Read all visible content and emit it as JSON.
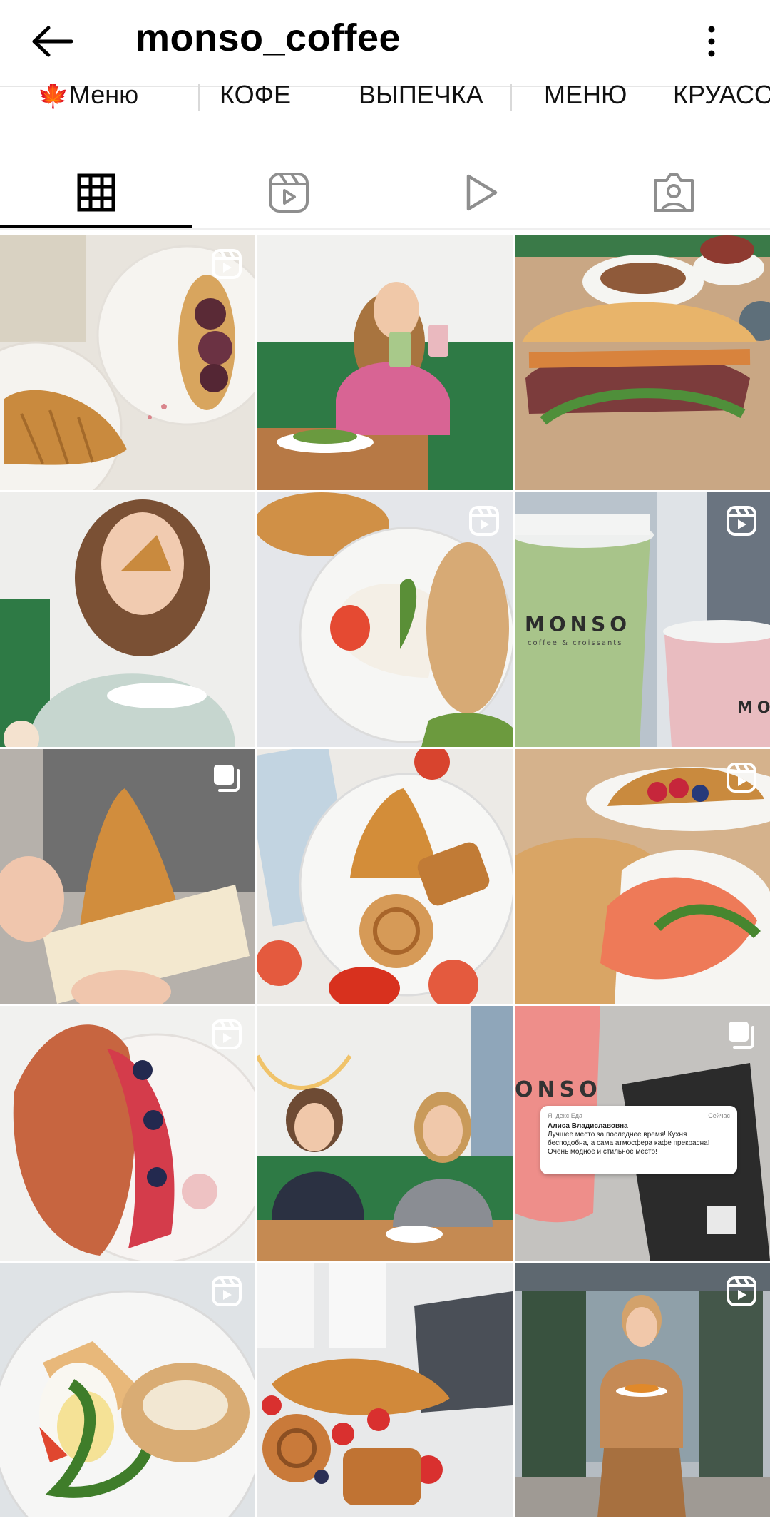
{
  "header": {
    "title": "monso_coffee",
    "back_icon": "arrow-left-icon",
    "more_icon": "more-vertical-icon"
  },
  "highlights": [
    {
      "label": "🍁Меню"
    },
    {
      "label": "КОФЕ"
    },
    {
      "label": "ВЫПЕЧКА"
    },
    {
      "label": "МЕНЮ"
    },
    {
      "label": "КРУАССАНЫ"
    }
  ],
  "tabs": [
    {
      "name": "posts",
      "icon": "grid-icon",
      "active": true
    },
    {
      "name": "reels",
      "icon": "reels-icon",
      "active": false
    },
    {
      "name": "videos",
      "icon": "play-icon",
      "active": false
    },
    {
      "name": "tagged",
      "icon": "tagged-person-icon",
      "active": false
    }
  ],
  "posts": [
    {
      "kind": "reel",
      "subject": "croissant with figs"
    },
    {
      "kind": "photo",
      "subject": "woman with green cup on sofa"
    },
    {
      "kind": "photo",
      "subject": "roast beef croissant sandwich"
    },
    {
      "kind": "photo",
      "subject": "woman eating croissant"
    },
    {
      "kind": "reel",
      "subject": "sandwich with pesto"
    },
    {
      "kind": "reel",
      "subject": "MONSO cups",
      "brand_text": "MONSO",
      "brand_subtext": "coffee & croissants",
      "brand_text_2": "MO"
    },
    {
      "kind": "carousel",
      "subject": "croissant in paper"
    },
    {
      "kind": "photo",
      "subject": "pastries on plate"
    },
    {
      "kind": "reel",
      "subject": "salmon croissant"
    },
    {
      "kind": "reel",
      "subject": "berry croissant"
    },
    {
      "kind": "photo",
      "subject": "two women in cafe"
    },
    {
      "kind": "carousel",
      "subject": "review card",
      "brand_text": "ONSO",
      "review": {
        "source": "Яндекс Еда",
        "time": "Сейчас",
        "author": "Алиса Владиславовна",
        "text": "Лучшее место за последнее время! Кухня бесподобна, а сама атмосфера кафе прекрасна! Очень модное и стильное место!"
      }
    },
    {
      "kind": "reel",
      "subject": "croissant with egg and pesto"
    },
    {
      "kind": "photo",
      "subject": "croissants and berries"
    },
    {
      "kind": "reel",
      "subject": "woman at entrance"
    }
  ],
  "colors": {
    "accent": "#000000",
    "cafe_green": "#2f7a48",
    "cup_green": "#a9c48a",
    "cup_pink": "#e9bcc0",
    "divider": "#e6e6e6"
  }
}
